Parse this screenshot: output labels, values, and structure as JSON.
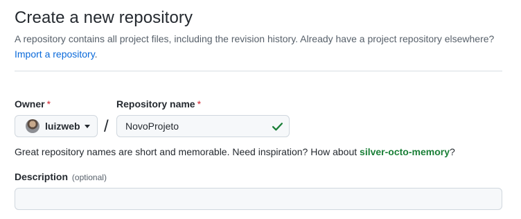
{
  "header": {
    "title": "Create a new repository",
    "description": "A repository contains all project files, including the revision history. Already have a project repository elsewhere?",
    "import_link": "Import a repository",
    "import_suffix": "."
  },
  "owner": {
    "label": "Owner",
    "required_mark": "*",
    "value": "luizweb"
  },
  "separator": "/",
  "repository": {
    "label": "Repository name",
    "required_mark": "*",
    "value": "NovoProjeto",
    "valid": true
  },
  "hint": {
    "text": "Great repository names are short and memorable. Need inspiration? How about ",
    "suggestion": "silver-octo-memory",
    "suffix": "?"
  },
  "description_field": {
    "label": "Description",
    "optional": "(optional)",
    "value": ""
  },
  "colors": {
    "link": "#0969da",
    "success": "#1a7f37",
    "required": "#cf222e"
  }
}
